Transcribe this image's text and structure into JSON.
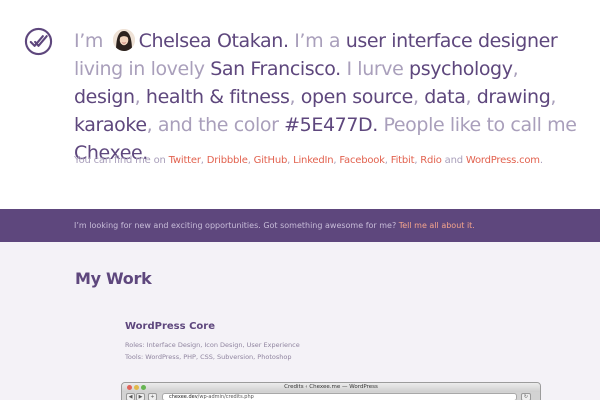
{
  "intro": {
    "parts": [
      {
        "text": "I’m ",
        "hl": false
      },
      {
        "avatar": true
      },
      {
        "text": "Chelsea Otakan.",
        "hl": true
      },
      {
        "text": " I’m a ",
        "hl": false
      },
      {
        "text": "user interface designer",
        "hl": true
      },
      {
        "text": " living in lovely ",
        "hl": false
      },
      {
        "text": "San Francisco.",
        "hl": true
      },
      {
        "text": " I lurve ",
        "hl": false
      },
      {
        "text": "psychology",
        "hl": true
      },
      {
        "text": ", ",
        "hl": false
      },
      {
        "text": "design",
        "hl": true
      },
      {
        "text": ", ",
        "hl": false
      },
      {
        "text": "health & fitness",
        "hl": true
      },
      {
        "text": ", ",
        "hl": false
      },
      {
        "text": "open source",
        "hl": true
      },
      {
        "text": ", ",
        "hl": false
      },
      {
        "text": "data",
        "hl": true
      },
      {
        "text": ", ",
        "hl": false
      },
      {
        "text": "drawing",
        "hl": true
      },
      {
        "text": ", ",
        "hl": false
      },
      {
        "text": "karaoke",
        "hl": true
      },
      {
        "text": ", and the color ",
        "hl": false
      },
      {
        "text": "#5E477D.",
        "hl": true
      },
      {
        "text": " People like to call me ",
        "hl": false
      },
      {
        "text": "Chexee.",
        "hl": true
      }
    ]
  },
  "find_me": {
    "prefix": "You can find me on ",
    "links": [
      "Twitter",
      "Dribbble",
      "GitHub",
      "LinkedIn",
      "Facebook",
      "Fitbit",
      "Rdio"
    ],
    "and": " and ",
    "last_link": "WordPress.com",
    "suffix": "."
  },
  "banner": {
    "text": "I’m looking for new and exciting opportunities. Got something awesome for me? ",
    "link": "Tell me all about it."
  },
  "work": {
    "title": "My Work",
    "project": {
      "title": "WordPress Core",
      "roles": "Roles: Interface Design, Icon Design, User Experience",
      "tools": "Tools: WordPress, PHP, CSS, Subversion, Photoshop"
    }
  },
  "browser": {
    "title": "Credits ‹ Chexee.me — WordPress",
    "url_domain": "chexee.dev",
    "url_path": "/wp-admin/credits.php"
  },
  "colors": {
    "accent": "#5E477D",
    "muted_text": "#A99FBB",
    "link": "#E2624F",
    "banner_link": "#F4A48C"
  }
}
